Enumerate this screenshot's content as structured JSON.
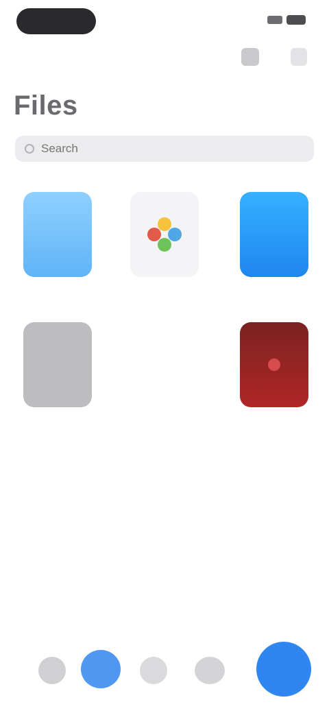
{
  "status_bar": {},
  "header": {
    "title": "Files",
    "select_icon": "select-icon",
    "more_icon": "more-icon"
  },
  "search": {
    "placeholder": "Search",
    "icon": "search-icon"
  },
  "grid": {
    "items": [
      {
        "name": "folder-blue-light",
        "color": "#6fbef7",
        "label": ""
      },
      {
        "name": "photos-app",
        "color": "#f4f4f6",
        "label": ""
      },
      {
        "name": "folder-blue",
        "color": "#2a97f5",
        "label": ""
      },
      {
        "name": "folder-gray",
        "color": "#bdbdc0",
        "label": ""
      },
      {
        "name": "item-blank",
        "color": "#ffffff",
        "label": ""
      },
      {
        "name": "app-red",
        "color": "#9e2424",
        "label": ""
      }
    ]
  },
  "tab_bar": {
    "tabs": [
      {
        "icon": "tab-icon-1",
        "active": false
      },
      {
        "icon": "tab-icon-2",
        "active": true,
        "color": "#4f97f0"
      },
      {
        "icon": "tab-icon-3",
        "active": false
      },
      {
        "icon": "tab-icon-4",
        "active": false
      }
    ],
    "fab": {
      "icon": "add-icon",
      "color": "#2f86f0"
    }
  }
}
